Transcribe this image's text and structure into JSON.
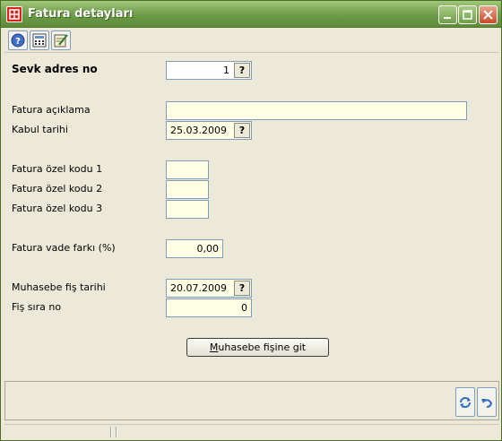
{
  "window": {
    "title": "Fatura detayları"
  },
  "toolbar": {
    "icons": [
      "help-icon",
      "calculator-icon",
      "edit-icon"
    ]
  },
  "form": {
    "sevk_adres_no": {
      "label": "Sevk adres no",
      "value": "1"
    },
    "fatura_aciklama": {
      "label": "Fatura açıklama",
      "value": ""
    },
    "kabul_tarihi": {
      "label": "Kabul tarihi",
      "value": "25.03.2009"
    },
    "ozel_kodu_1": {
      "label": "Fatura özel kodu 1",
      "value": ""
    },
    "ozel_kodu_2": {
      "label": "Fatura özel kodu 2",
      "value": ""
    },
    "ozel_kodu_3": {
      "label": "Fatura özel kodu 3",
      "value": ""
    },
    "vade_farki": {
      "label": "Fatura vade farkı (%)",
      "value": "0,00"
    },
    "muhasebe_fis_tarihi": {
      "label": "Muhasebe fiş tarihi",
      "value": "20.07.2009"
    },
    "fis_sira_no": {
      "label": "Fiş sıra no",
      "value": "0"
    },
    "lookup_symbol": "?"
  },
  "actions": {
    "muhasebe_button": {
      "mnemonic": "M",
      "rest": "uhasebe fişine git"
    }
  },
  "colors": {
    "titlebar": "#6b9a46",
    "window_bg": "#ece9d8",
    "field_bg": "#ffffe6",
    "close_button": "#c8492a"
  }
}
